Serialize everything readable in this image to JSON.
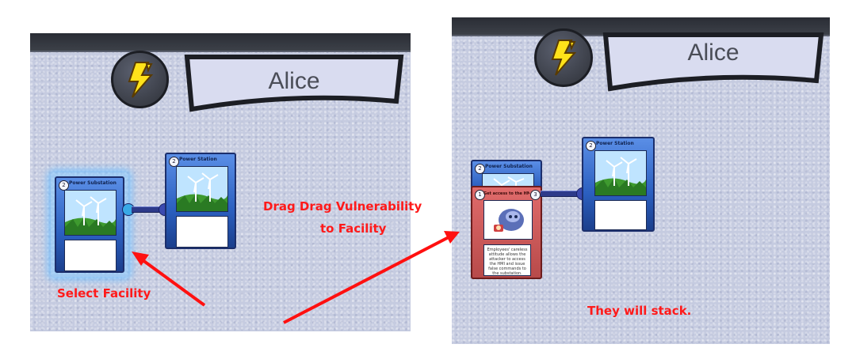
{
  "left_panel": {
    "player_name": "Alice",
    "card_selected": {
      "number": "2",
      "title": "Power Substation"
    },
    "card_linked": {
      "number": "2",
      "title": "Power Station"
    }
  },
  "right_panel": {
    "player_name": "Alice",
    "card_back": {
      "number": "2",
      "title": "Power Substation"
    },
    "card_vulnerability": {
      "number": "1",
      "cost": "3",
      "title": "Get access to the HMI & Engi...",
      "body": "Employees' careless attitude allows the attacker to access the HMI and issue false commands to the substation."
    },
    "card_linked": {
      "number": "2",
      "title": "Power Station"
    }
  },
  "annotations": {
    "select": "Select Facility",
    "drag_line1": "Drag Drag Vulnerability",
    "drag_line2": "to Facility",
    "stack": "They will stack."
  },
  "colors": {
    "annotation": "#ff1a1a",
    "card_blue": "#2b5fbf",
    "card_red": "#b84a4a",
    "bolt": "#ffe21a"
  },
  "icons": [
    "lightning-bolt-icon",
    "wind-turbine-icon",
    "hacker-character-icon"
  ]
}
